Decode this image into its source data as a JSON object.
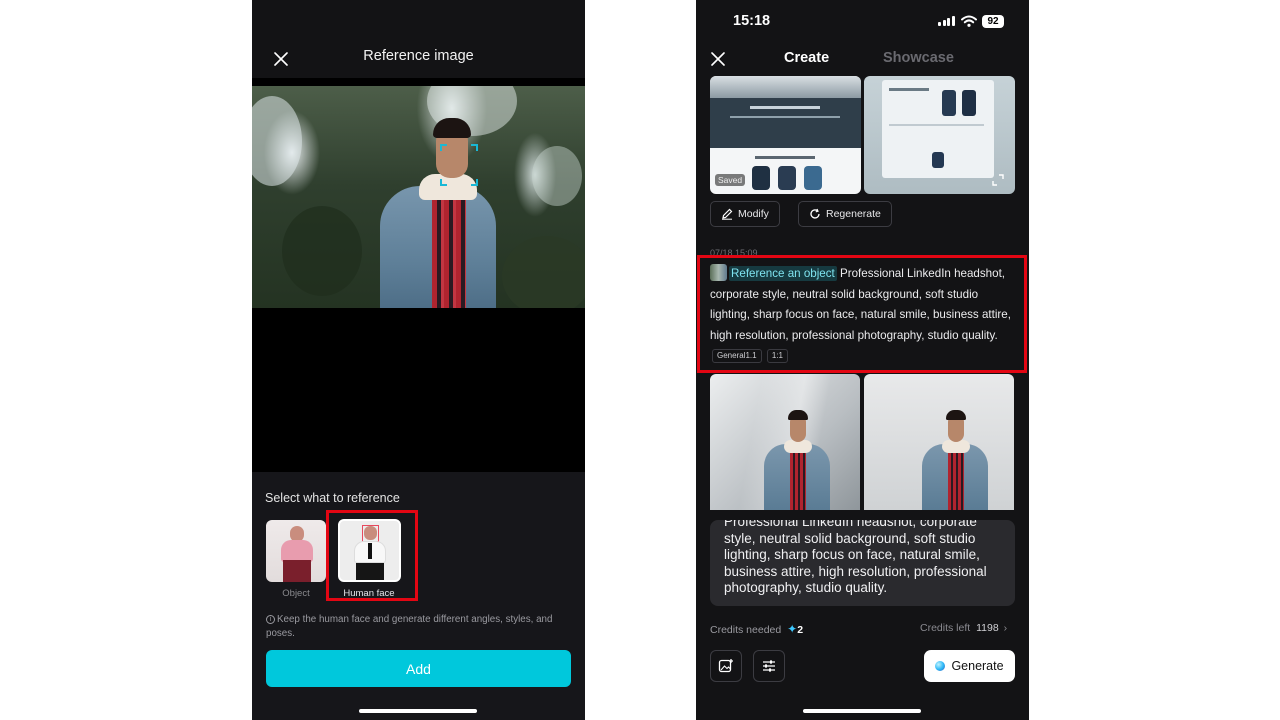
{
  "left_screen": {
    "title": "Reference image",
    "select_label": "Select what to reference",
    "options": [
      {
        "label": "Object"
      },
      {
        "label": "Human face"
      }
    ],
    "info_text": "Keep the human face and generate different angles, styles, and poses.",
    "add_label": "Add"
  },
  "right_screen": {
    "status": {
      "time": "15:18",
      "battery": "92"
    },
    "tabs": [
      "Create",
      "Showcase"
    ],
    "saved_badge": "Saved",
    "modify_label": "Modify",
    "regenerate_label": "Regenerate",
    "timestamp": "07/18 15:09",
    "reference_chip": "Reference an object",
    "prompt": "Professional LinkedIn headshot, corporate style, neutral solid background, soft studio lighting, sharp focus on face, natural smile, business attire, high resolution, professional photography, studio quality.",
    "model_tag": "General1.1",
    "ratio_tag": "1:1",
    "input_text": "Professional LinkedIn headshot, corporate style, neutral solid background, soft studio lighting, sharp focus on face, natural smile, business attire, high resolution, professional photography, studio quality.",
    "credits_needed_label": "Credits needed",
    "credits_needed_value": "2",
    "credits_left_label": "Credits left",
    "credits_left_value": "1198",
    "generate_label": "Generate"
  },
  "colors": {
    "accent": "#00c8dc",
    "highlight": "#e30613",
    "background": "#131315"
  },
  "icons": [
    "close-icon",
    "info-icon",
    "pencil-icon",
    "refresh-icon",
    "image-add-icon",
    "sliders-icon",
    "sparkle-icon",
    "chevron-right-icon",
    "signal-icon",
    "wifi-icon",
    "battery-icon",
    "expand-icon"
  ]
}
